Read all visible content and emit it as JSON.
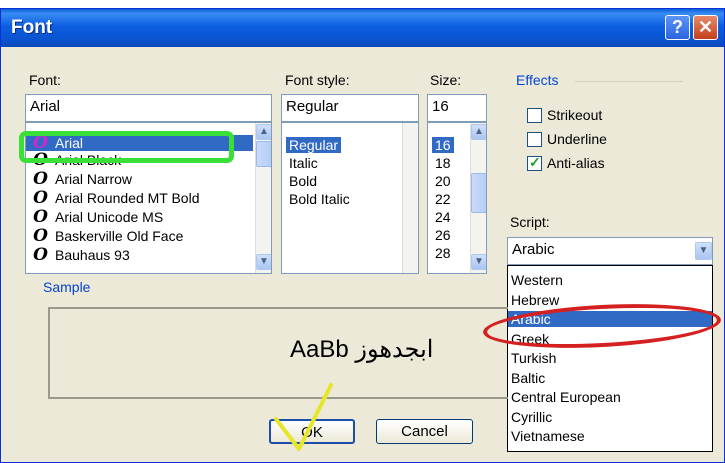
{
  "window": {
    "title": "Font",
    "help_icon": "?",
    "close_icon": "✕"
  },
  "font": {
    "label": "Font:",
    "value": "Arial",
    "items": [
      {
        "icon": "O",
        "label": "Arial"
      },
      {
        "icon": "O",
        "label": "Arial Black"
      },
      {
        "icon": "O",
        "label": "Arial Narrow"
      },
      {
        "icon": "O",
        "label": "Arial Rounded MT Bold"
      },
      {
        "icon": "O",
        "label": "Arial Unicode MS"
      },
      {
        "icon": "O",
        "label": "Baskerville Old Face"
      },
      {
        "icon": "O",
        "label": "Bauhaus 93"
      }
    ],
    "selected_index": 0
  },
  "style": {
    "label": "Font style:",
    "value": "Regular",
    "items": [
      "Regular",
      "Italic",
      "Bold",
      "Bold Italic"
    ],
    "selected_index": 0
  },
  "size": {
    "label": "Size:",
    "value": "16",
    "items": [
      "16",
      "18",
      "20",
      "22",
      "24",
      "26",
      "28"
    ],
    "selected_index": 0
  },
  "effects": {
    "label": "Effects",
    "strikeout": {
      "label": "Strikeout",
      "checked": false
    },
    "underline": {
      "label": "Underline",
      "checked": false
    },
    "antialias": {
      "label": "Anti-alias",
      "checked": true
    }
  },
  "script": {
    "label": "Script:",
    "value": "Arabic",
    "options": [
      "Western",
      "Hebrew",
      "Arabic",
      "Greek",
      "Turkish",
      "Baltic",
      "Central European",
      "Cyrillic",
      "Vietnamese"
    ],
    "highlighted_index": 2
  },
  "sample": {
    "label": "Sample",
    "text": "AaBb ابجدهوز"
  },
  "buttons": {
    "ok": "OK",
    "cancel": "Cancel"
  },
  "colors": {
    "selection": "#316ac5",
    "title_bar": "#0a5fd8",
    "highlight_green": "#38e038",
    "highlight_red": "#d42020"
  }
}
